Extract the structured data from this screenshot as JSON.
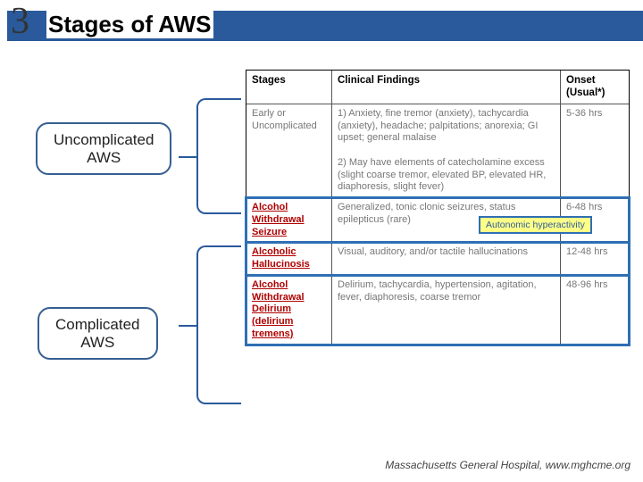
{
  "title": {
    "number": "3",
    "text": "Stages of AWS"
  },
  "badges": {
    "uncomplicated": "Uncomplicated\nAWS",
    "complicated": "Complicated\nAWS"
  },
  "callout": {
    "autonomic": "Autonomic hyperactivity"
  },
  "footer": "Massachusetts General Hospital, www.mghcme.org",
  "table": {
    "headers": {
      "stages": "Stages",
      "findings": "Clinical Findings",
      "onset": "Onset (Usual*)"
    },
    "rows": [
      {
        "stage": "Early or\nUncomplicated",
        "stage_red": false,
        "findings": "1)  Anxiety, fine tremor (anxiety), tachycardia (anxiety), headache; palpitations; anorexia; GI upset; general malaise\n\n2)  May have elements of catecholamine excess (slight coarse tremor, elevated BP, elevated HR, diaphoresis, slight fever)",
        "onset": "5-36 hrs"
      },
      {
        "stage": "Alcohol\nWithdrawal\nSeizure",
        "stage_red": true,
        "findings": "Generalized, tonic clonic seizures, status epilepticus (rare)",
        "onset": "6-48 hrs"
      },
      {
        "stage": "Alcoholic\nHallucinosis",
        "stage_red": true,
        "findings": "Visual, auditory, and/or tactile hallucinations",
        "onset": "12-48 hrs"
      },
      {
        "stage": "Alcohol\nWithdrawal\nDelirium\n(delirium\ntremens)",
        "stage_red": true,
        "findings": "Delirium, tachycardia, hypertension, agitation, fever, diaphoresis, coarse tremor",
        "onset": "48-96 hrs"
      }
    ]
  }
}
